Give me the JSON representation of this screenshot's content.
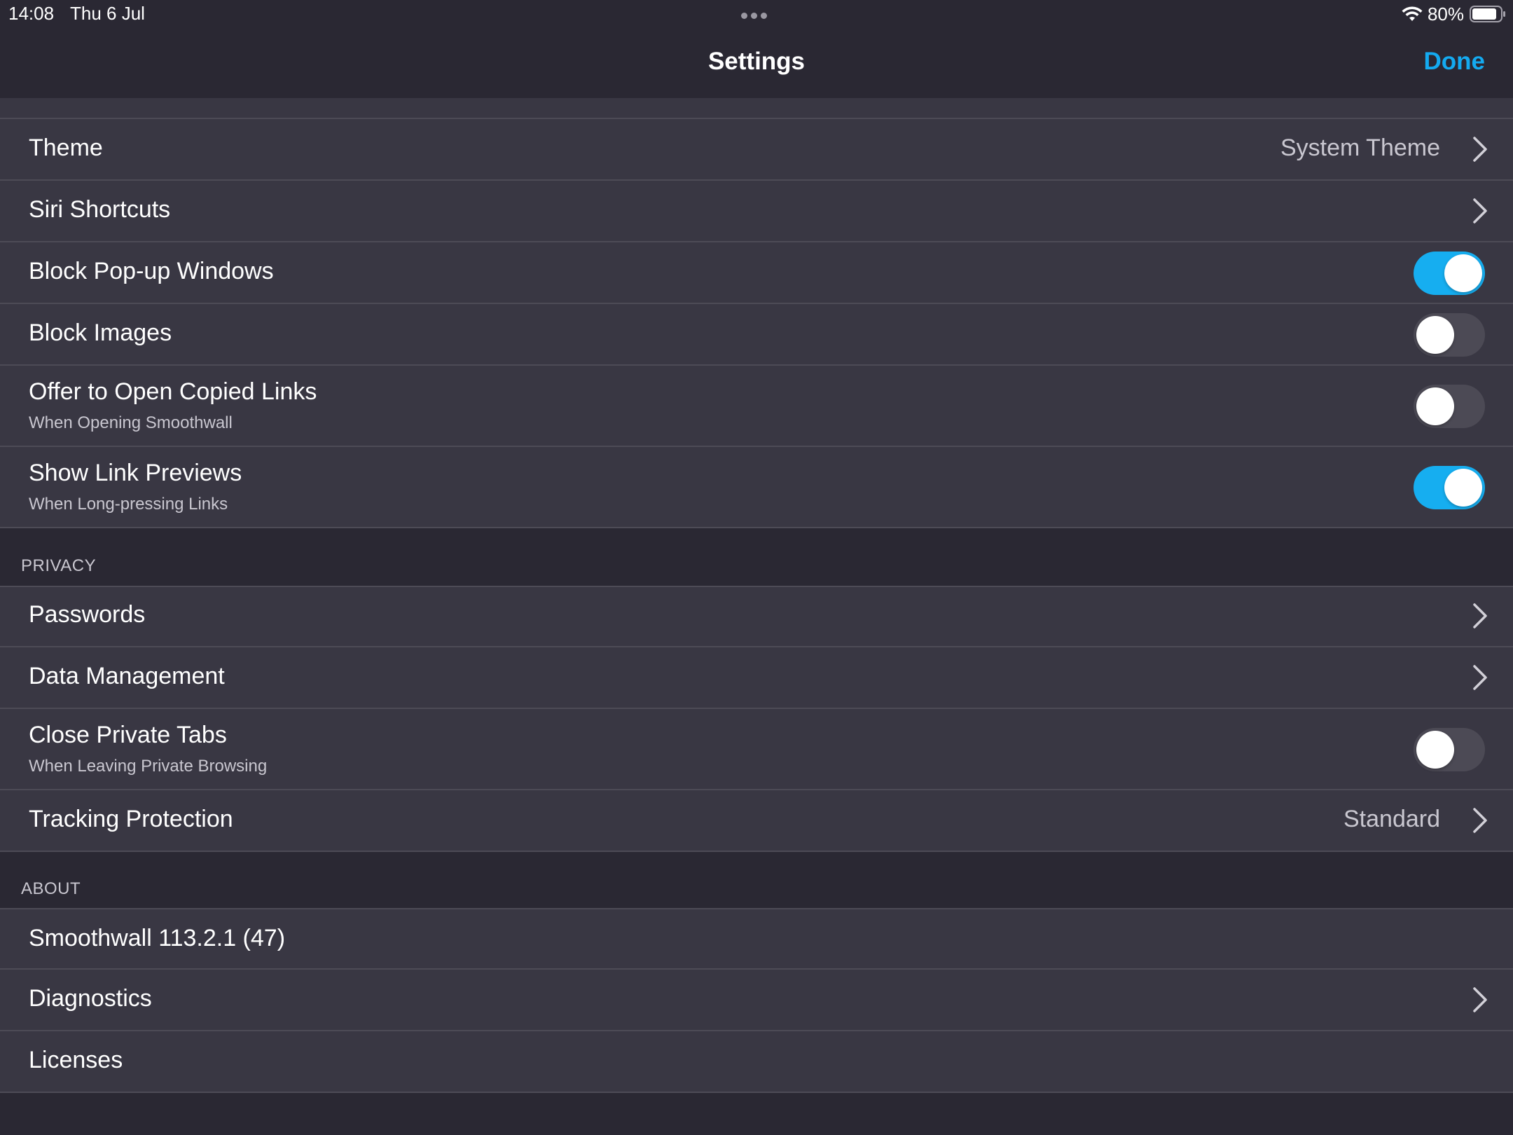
{
  "status_bar": {
    "time": "14:08",
    "date": "Thu 6 Jul",
    "battery_percent": "80%",
    "wifi_icon": "wifi-icon",
    "battery_icon": "battery-icon",
    "battery_level": 0.8
  },
  "nav": {
    "title": "Settings",
    "done_label": "Done",
    "accent_color": "#14aaf0"
  },
  "general_rows": {
    "theme": {
      "label": "Theme",
      "value": "System Theme"
    },
    "siri": {
      "label": "Siri Shortcuts"
    },
    "block_popups": {
      "label": "Block Pop-up Windows",
      "on": true
    },
    "block_images": {
      "label": "Block Images",
      "on": false
    },
    "copied_links": {
      "label": "Offer to Open Copied Links",
      "sub": "When Opening Smoothwall",
      "on": false
    },
    "link_previews": {
      "label": "Show Link Previews",
      "sub": "When Long-pressing Links",
      "on": true
    }
  },
  "privacy": {
    "header": "PRIVACY",
    "passwords": {
      "label": "Passwords"
    },
    "data_management": {
      "label": "Data Management"
    },
    "close_private_tabs": {
      "label": "Close Private Tabs",
      "sub": "When Leaving Private Browsing",
      "on": false
    },
    "tracking_protection": {
      "label": "Tracking Protection",
      "value": "Standard"
    }
  },
  "about": {
    "header": "ABOUT",
    "version": {
      "label": "Smoothwall 113.2.1 (47)"
    },
    "diagnostics": {
      "label": "Diagnostics"
    },
    "licenses": {
      "label": "Licenses"
    }
  },
  "colors": {
    "background": "#2a2833",
    "row_background": "#393743",
    "toggle_on": "#16aef0",
    "toggle_off": "#4c4a55"
  }
}
